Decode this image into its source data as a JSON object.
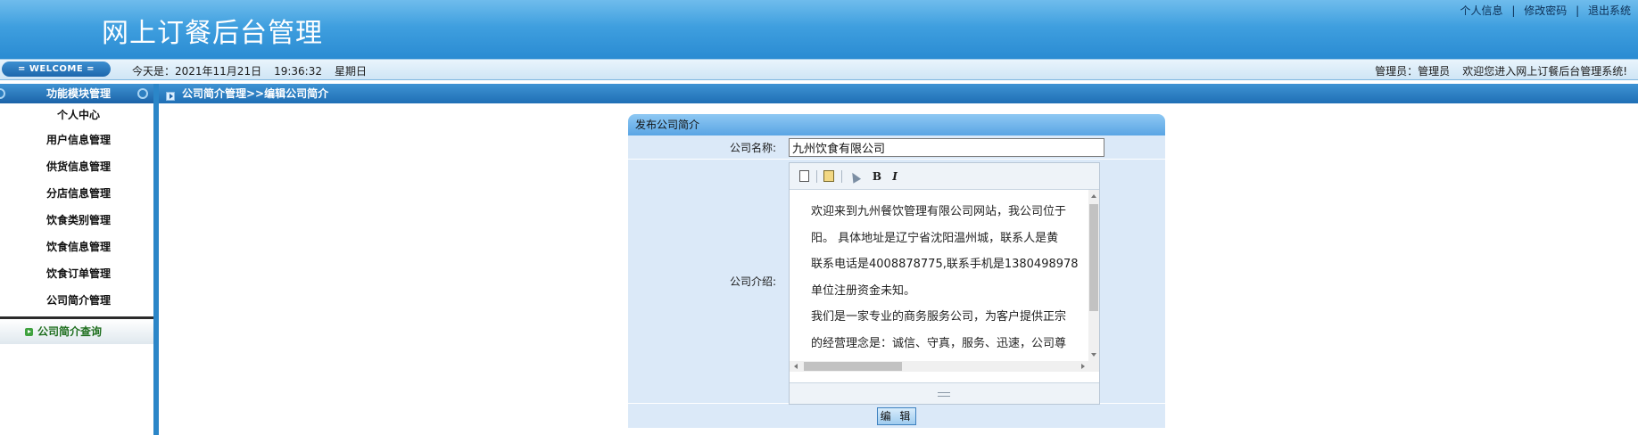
{
  "header": {
    "title": "网上订餐后台管理",
    "links": [
      "个人信息",
      "修改密码",
      "退出系统"
    ],
    "separator": "|"
  },
  "infobar": {
    "welcome": "= WELCOME =",
    "today_label": "今天是：2021年11月21日",
    "time": "19:36:32",
    "weekday": "星期日",
    "admin_label": "管理员：管理员",
    "greeting": "欢迎您进入网上订餐后台管理系统!"
  },
  "sidebar": {
    "title": "功能模块管理",
    "items": [
      "个人中心",
      "用户信息管理",
      "供货信息管理",
      "分店信息管理",
      "饮食类别管理",
      "饮食信息管理",
      "饮食订单管理",
      "公司简介管理"
    ],
    "sub_item": "公司简介查询"
  },
  "breadcrumb": "公司简介管理>>编辑公司简介",
  "form": {
    "title": "发布公司简介",
    "name_label": "公司名称:",
    "name_value": "九州饮食有限公司",
    "intro_label": "公司介绍:",
    "intro_lines": [
      "欢迎来到九州餐饮管理有限公司网站，我公司位于",
      "阳。 具体地址是辽宁省沈阳温州城，联系人是黄",
      "联系电话是4008878775,联系手机是1380498978",
      "单位注册资金未知。",
      "我们是一家专业的商务服务公司，为客户提供正宗",
      "的经营理念是：诚信、守真，服务、迅速，公司尊"
    ],
    "toolbar": {
      "bold": "B",
      "italic": "I"
    },
    "submit_label": "编 辑"
  },
  "colors": {
    "header_blue": "#2a8bd2",
    "panel_bg": "#dbe9f8",
    "sub_item_green": "#1f6f1f"
  }
}
